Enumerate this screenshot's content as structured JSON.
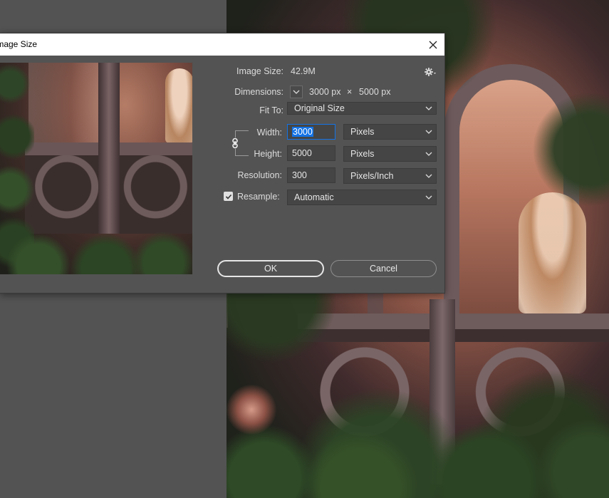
{
  "dialog": {
    "title": "Image Size",
    "image_size_label": "Image Size:",
    "image_size_value": "42.9M",
    "dimensions_label": "Dimensions:",
    "dimensions_width": "3000 px",
    "dimensions_times": "×",
    "dimensions_height": "5000 px",
    "fit_to_label": "Fit To:",
    "fit_to_value": "Original Size",
    "width_label": "Width:",
    "width_value": "3000",
    "width_unit": "Pixels",
    "height_label": "Height:",
    "height_value": "5000",
    "height_unit": "Pixels",
    "resolution_label": "Resolution:",
    "resolution_value": "300",
    "resolution_unit": "Pixels/Inch",
    "resample_label": "Resample:",
    "resample_checked": true,
    "resample_value": "Automatic",
    "ok_label": "OK",
    "cancel_label": "Cancel"
  },
  "icons": {
    "close": "close-icon",
    "settings": "gear-icon",
    "link": "link-icon",
    "dropdown": "chevron-down-icon",
    "check": "check-icon"
  },
  "colors": {
    "workspace": "#535353",
    "dialog_bg": "#535353",
    "field_bg": "#454545",
    "focus": "#1473e6",
    "titlebar": "#ffffff"
  }
}
